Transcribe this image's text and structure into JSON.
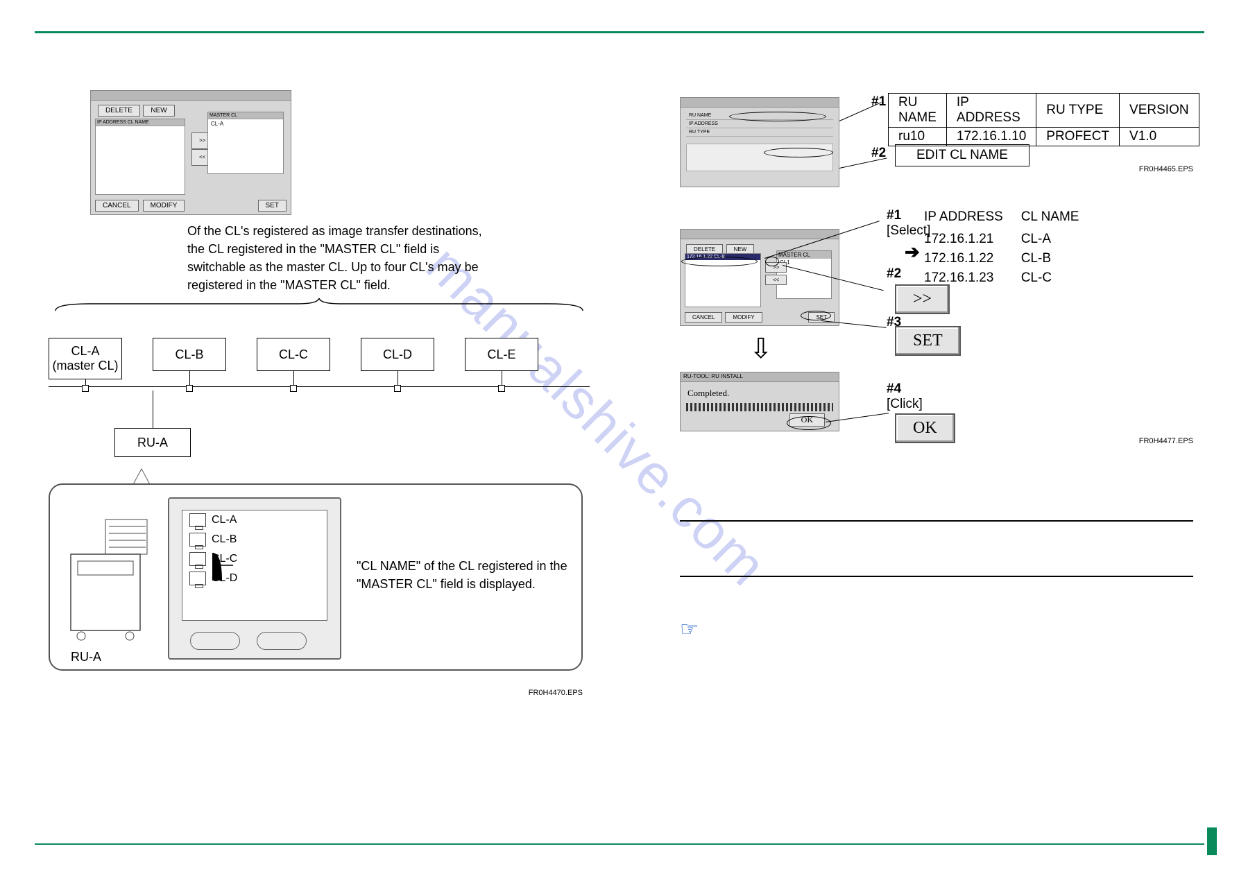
{
  "watermark": "manualshive.com",
  "left": {
    "dlg1": {
      "btn_delete": "DELETE",
      "btn_new": "NEW",
      "list_header": "IP ADDRESS   CL NAME",
      "master_header": "MASTER CL",
      "master_item": "CL-A",
      "arrows_right": ">>",
      "arrows_left": "<<",
      "btn_cancel": "CANCEL",
      "btn_modify": "MODIFY",
      "btn_set": "SET"
    },
    "caption": "Of the CL's registered as image transfer destinations, the CL registered in the \"MASTER CL\" field is switchable as the master CL. Up to four CL's may be registered in the \"MASTER CL\" field.",
    "cl_boxes": {
      "a1": "CL-A",
      "a2": "(master CL)",
      "b": "CL-B",
      "c": "CL-C",
      "d": "CL-D",
      "e": "CL-E"
    },
    "ru_box": "RU-A",
    "ru_label": "RU-A",
    "screen_items": {
      "a": "CL-A",
      "b": "CL-B",
      "c": "CL-C",
      "d": "CL-D"
    },
    "right_note": "\"CL NAME\" of the CL registered in the \"MASTER CL\" field is displayed.",
    "eps": "FR0H4470.EPS"
  },
  "right": {
    "steps": {
      "s1": "#1",
      "s2": "#2",
      "s3": "#3",
      "s4": "#4",
      "select": "[Select]",
      "click": "[Click]"
    },
    "ru_table": {
      "h1": "RU NAME",
      "h2": "IP ADDRESS",
      "h3": "RU TYPE",
      "h4": "VERSION",
      "v1": "ru10",
      "v2": "172.16.1.10",
      "v3": "PROFECT",
      "v4": "V1.0"
    },
    "edit_label": "EDIT CL NAME",
    "eps1": "FR0H4465.EPS",
    "dlg_mid": {
      "btn_delete": "DELETE",
      "btn_new": "NEW",
      "list_sel": "172.16.1.22   CL-B",
      "master_header": "MASTER CL",
      "master_item": "CL1",
      "btn_cancel": "CANCEL",
      "btn_modify": "MODIFY",
      "btn_set": "SET"
    },
    "ip_list": {
      "h1": "IP ADDRESS",
      "h2": "CL NAME",
      "r1a": "172.16.1.21",
      "r1b": "CL-A",
      "r2a": "172.16.1.22",
      "r2b": "CL-B",
      "r3a": "172.16.1.23",
      "r3b": "CL-C"
    },
    "marker": "➔",
    "btn_shift": ">>",
    "btn_set": "SET",
    "btn_ok": "OK",
    "down_arrow": "⇩",
    "dlg_bot": {
      "title": "RU-TOOL: RU INSTALL",
      "msg": "Completed.",
      "ok": "OK"
    },
    "eps2": "FR0H4477.EPS"
  }
}
